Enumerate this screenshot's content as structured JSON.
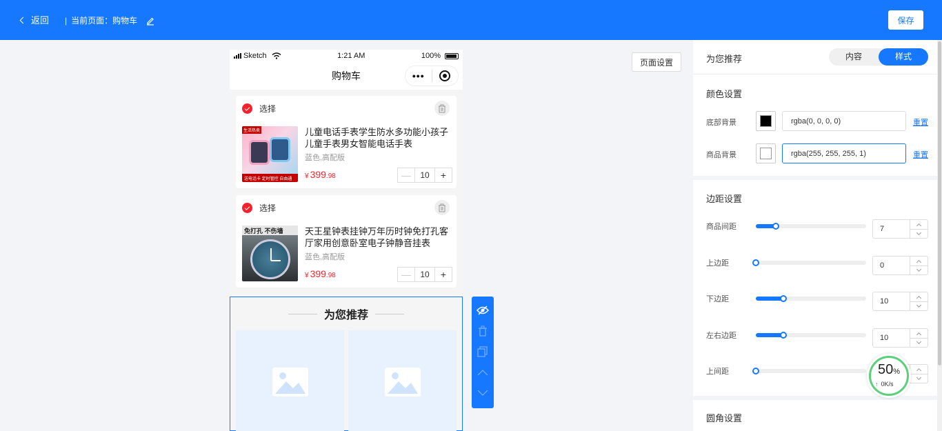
{
  "topbar": {
    "back_label": "返回",
    "current_page_label": "当前页面：购物车",
    "save_label": "保存"
  },
  "phone": {
    "status": {
      "carrier": "Sketch",
      "time": "1:21 AM",
      "battery": "100%"
    },
    "nav_title": "购物车",
    "capsule_dots": "•••",
    "items": [
      {
        "select_label": "选择",
        "name": "儿童电话手表学生防水多功能小孩子儿童手表男女智能电话手表",
        "spec": "蓝色,高配版",
        "price_symbol": "¥",
        "price_int": "399",
        "price_dec": ".98",
        "qty": "10",
        "thumb_tag": "生活热卖",
        "thumb_foot": "送电话卡 定时管控 自由通话"
      },
      {
        "select_label": "选择",
        "name": "天王星钟表挂钟万年历时钟免打孔客厅家用创意卧室电子钟静音挂表",
        "spec": "蓝色,高配版",
        "price_symbol": "¥",
        "price_int": "399",
        "price_dec": ".98",
        "qty": "10",
        "thumb_banner": "免打孔 不伤墙"
      }
    ],
    "stepper": {
      "minus": "—",
      "plus": "+"
    },
    "recommend_title": "为您推荐"
  },
  "page_settings_label": "页面设置",
  "panel": {
    "title": "为您推荐",
    "tabs": [
      {
        "label": "内容",
        "active": false
      },
      {
        "label": "样式",
        "active": true
      }
    ],
    "color_section": {
      "title": "颜色设置",
      "rows": [
        {
          "label": "底部背景",
          "value": "rgba(0, 0, 0, 0)",
          "swatch": "#000000",
          "reset": "重置"
        },
        {
          "label": "商品背景",
          "value": "rgba(255, 255, 255, 1)",
          "swatch": "#ffffff",
          "reset": "重置"
        }
      ]
    },
    "margin_section": {
      "title": "边距设置",
      "rows": [
        {
          "label": "商品间距",
          "value": "7",
          "fraction": 0.18
        },
        {
          "label": "上边距",
          "value": "0",
          "fraction": 0.0
        },
        {
          "label": "下边距",
          "value": "10",
          "fraction": 0.25
        },
        {
          "label": "左右边距",
          "value": "10",
          "fraction": 0.25
        },
        {
          "label": "上间距",
          "value": "0",
          "fraction": 0.0
        }
      ]
    },
    "radius_section": {
      "title": "圆角设置"
    }
  },
  "speed_widget": {
    "percent": "50",
    "percent_sign": "%",
    "rate": "0K/s"
  },
  "colors": {
    "accent": "#1677ff",
    "price": "#f5222d",
    "check": "#f5222d"
  }
}
